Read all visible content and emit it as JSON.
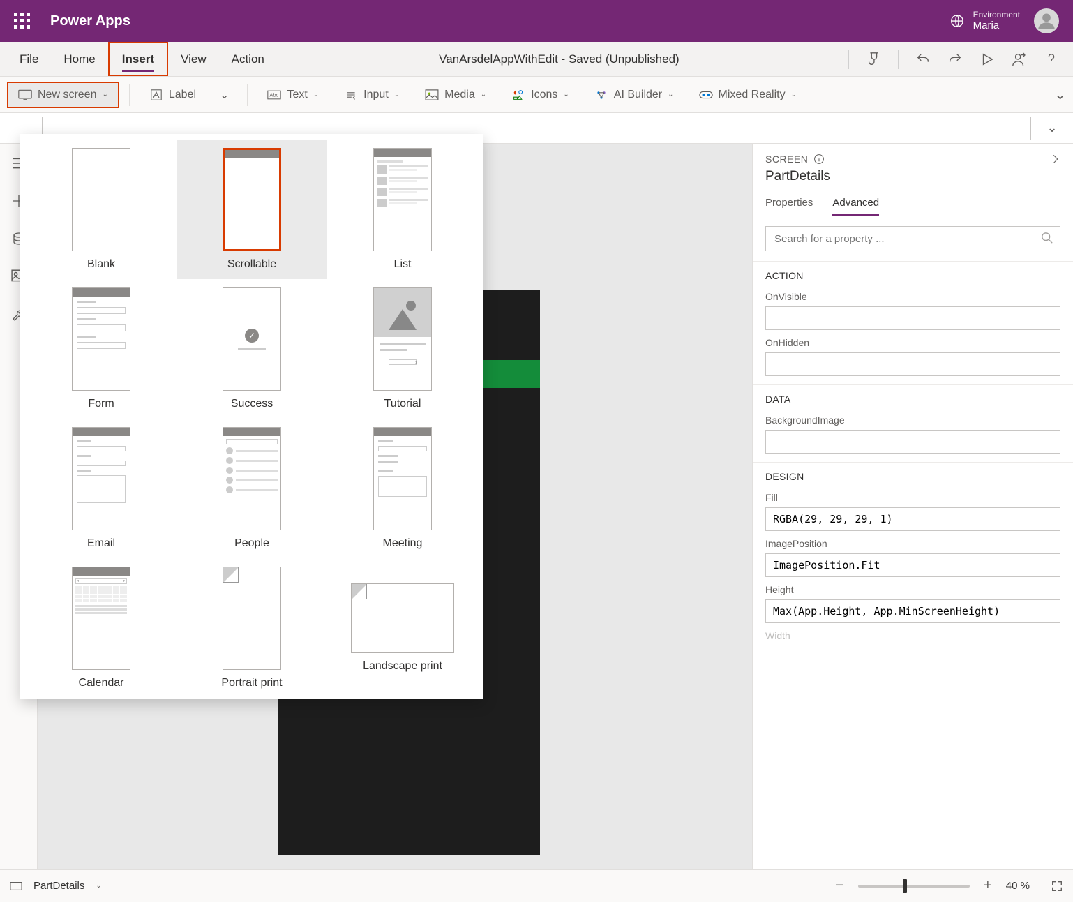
{
  "header": {
    "app_title": "Power Apps",
    "env_label": "Environment",
    "env_name": "Maria"
  },
  "menubar": {
    "tabs": [
      "File",
      "Home",
      "Insert",
      "View",
      "Action"
    ],
    "active_index": 2,
    "center_text": "VanArsdelAppWithEdit - Saved (Unpublished)"
  },
  "toolbar": {
    "new_screen": "New screen",
    "label": "Label",
    "text": "Text",
    "input": "Input",
    "media": "Media",
    "icons": "Icons",
    "ai_builder": "AI Builder",
    "mixed_reality": "Mixed Reality"
  },
  "gallery": {
    "items": [
      {
        "label": "Blank"
      },
      {
        "label": "Scrollable"
      },
      {
        "label": "List"
      },
      {
        "label": "Form"
      },
      {
        "label": "Success"
      },
      {
        "label": "Tutorial"
      },
      {
        "label": "Email"
      },
      {
        "label": "People"
      },
      {
        "label": "Meeting"
      },
      {
        "label": "Calendar"
      },
      {
        "label": "Portrait print"
      },
      {
        "label": "Landscape print"
      }
    ],
    "selected_index": 1
  },
  "rpanel": {
    "head_label": "SCREEN",
    "title": "PartDetails",
    "tabs": [
      "Properties",
      "Advanced"
    ],
    "active_tab": 1,
    "search_placeholder": "Search for a property ...",
    "sections": {
      "action": {
        "title": "ACTION",
        "fields": [
          {
            "label": "OnVisible",
            "value": ""
          },
          {
            "label": "OnHidden",
            "value": ""
          }
        ]
      },
      "data": {
        "title": "DATA",
        "fields": [
          {
            "label": "BackgroundImage",
            "value": ""
          }
        ]
      },
      "design": {
        "title": "DESIGN",
        "fields": [
          {
            "label": "Fill",
            "value": "RGBA(29, 29, 29, 1)"
          },
          {
            "label": "ImagePosition",
            "value": "ImagePosition.Fit"
          },
          {
            "label": "Height",
            "value": "Max(App.Height, App.MinScreenHeight)"
          },
          {
            "label": "Width",
            "value": ""
          }
        ]
      }
    }
  },
  "footer": {
    "screen_name": "PartDetails",
    "zoom": "40 %"
  }
}
